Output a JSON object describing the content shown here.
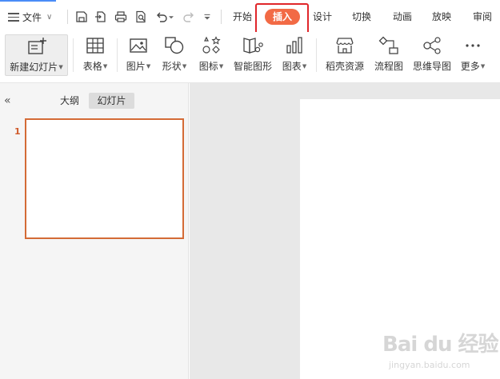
{
  "menu": {
    "label": "文件"
  },
  "tabs": [
    {
      "label": "开始",
      "active": false
    },
    {
      "label": "插入",
      "active": true
    },
    {
      "label": "设计",
      "active": false
    },
    {
      "label": "切换",
      "active": false
    },
    {
      "label": "动画",
      "active": false
    },
    {
      "label": "放映",
      "active": false
    },
    {
      "label": "审阅",
      "active": false
    }
  ],
  "ribbon": {
    "new_slide": "新建幻灯片",
    "table": "表格",
    "picture": "图片",
    "shape": "形状",
    "icon": "图标",
    "smartart": "智能图形",
    "chart": "图表",
    "daoke": "稻壳资源",
    "flowchart": "流程图",
    "mindmap": "思维导图",
    "more": "更多"
  },
  "panel": {
    "tab_outline": "大纲",
    "tab_slides": "幻灯片",
    "slide_number": "1"
  },
  "colors": {
    "accent": "#f26a45",
    "highlight": "#e0262a",
    "thumb_border": "#d46b36"
  },
  "watermark": {
    "brand": "Bai du 经验",
    "url": "jingyan.baidu.com"
  }
}
